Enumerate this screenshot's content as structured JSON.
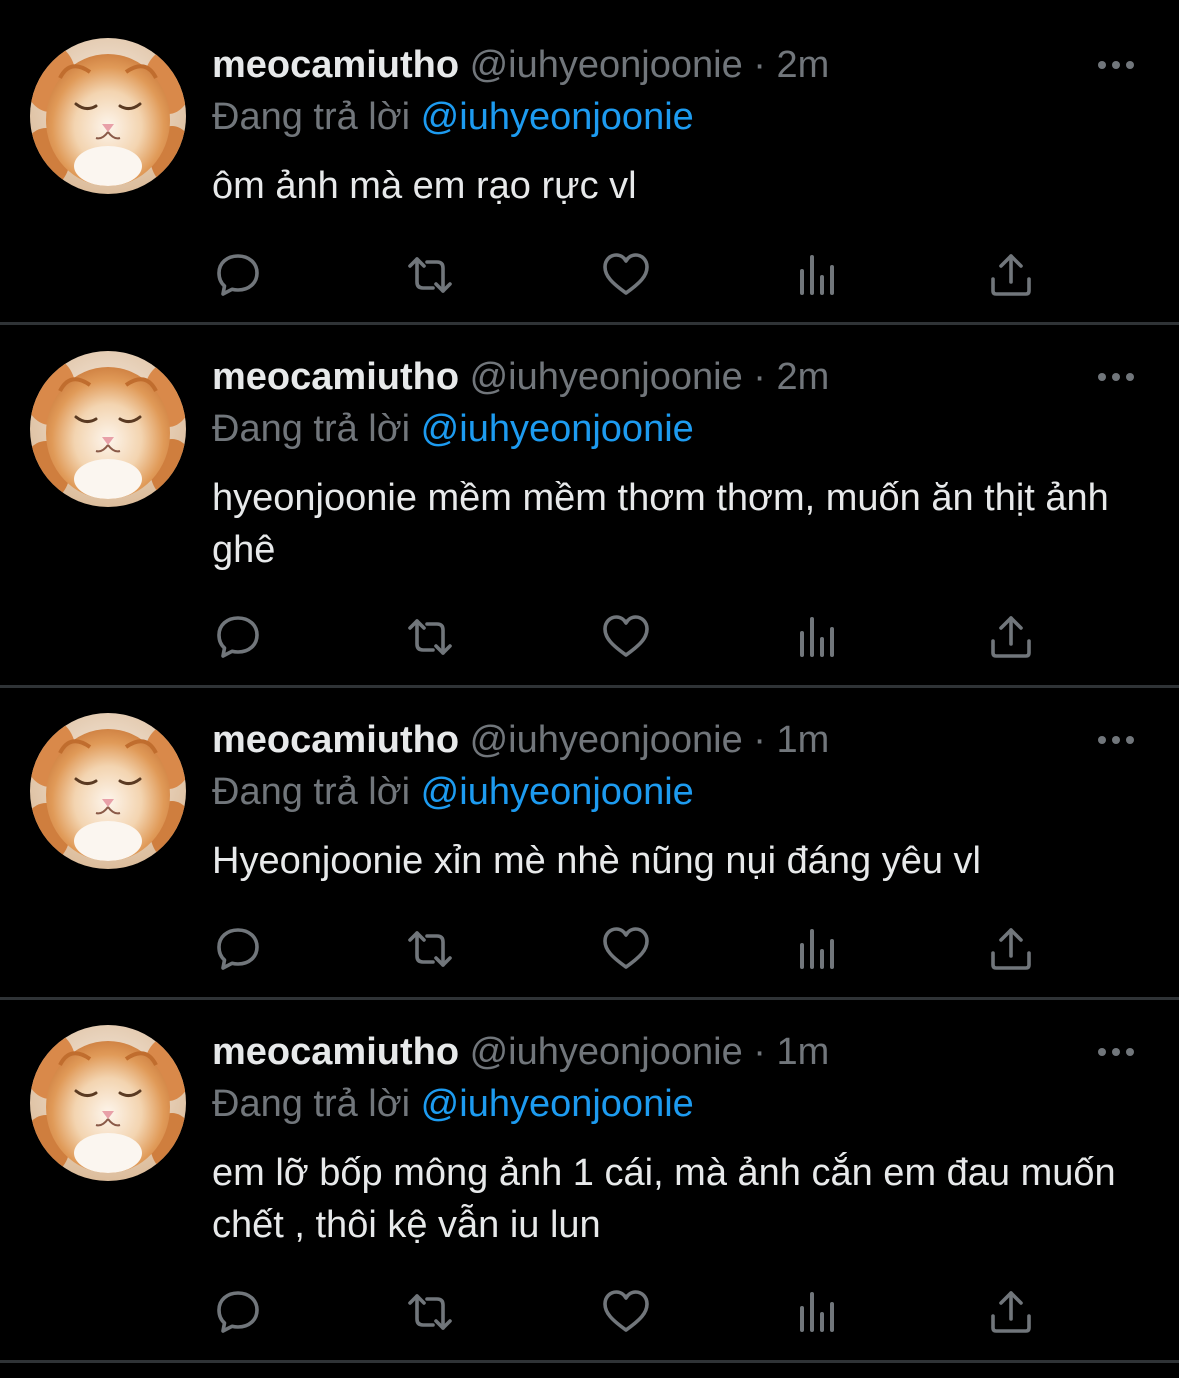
{
  "colors": {
    "background": "#000000",
    "text_primary": "#e7e9ea",
    "text_secondary": "#71767b",
    "mention": "#1d9bf0",
    "divider": "#2f3336"
  },
  "tweets": [
    {
      "display_name": "meocamiutho",
      "handle": "@iuhyeonjoonie",
      "separator": "·",
      "time": "2m",
      "replying_prefix": "Đang trả lời",
      "replying_to": "@iuhyeonjoonie",
      "text": "ôm ảnh mà em rạo rực vl",
      "icons": [
        "more-icon",
        "reply-icon",
        "retweet-icon",
        "like-icon",
        "analytics-icon",
        "share-icon"
      ]
    },
    {
      "display_name": "meocamiutho",
      "handle": "@iuhyeonjoonie",
      "separator": "·",
      "time": "2m",
      "replying_prefix": "Đang trả lời",
      "replying_to": "@iuhyeonjoonie",
      "text": "hyeonjoonie mềm mềm thơm thơm, muốn ăn thịt ảnh ghê",
      "icons": [
        "more-icon",
        "reply-icon",
        "retweet-icon",
        "like-icon",
        "analytics-icon",
        "share-icon"
      ]
    },
    {
      "display_name": "meocamiutho",
      "handle": "@iuhyeonjoonie",
      "separator": "·",
      "time": "1m",
      "replying_prefix": "Đang trả lời",
      "replying_to": "@iuhyeonjoonie",
      "text": "Hyeonjoonie xỉn mè nhè nũng nụi đáng yêu vl",
      "icons": [
        "more-icon",
        "reply-icon",
        "retweet-icon",
        "like-icon",
        "analytics-icon",
        "share-icon"
      ]
    },
    {
      "display_name": "meocamiutho",
      "handle": "@iuhyeonjoonie",
      "separator": "·",
      "time": "1m",
      "replying_prefix": "Đang trả lời",
      "replying_to": "@iuhyeonjoonie",
      "text": "em lỡ bốp mông ảnh 1 cái, mà ảnh cắn em đau muốn chết , thôi kệ vẫn iu lun",
      "icons": [
        "more-icon",
        "reply-icon",
        "retweet-icon",
        "like-icon",
        "analytics-icon",
        "share-icon"
      ]
    }
  ]
}
